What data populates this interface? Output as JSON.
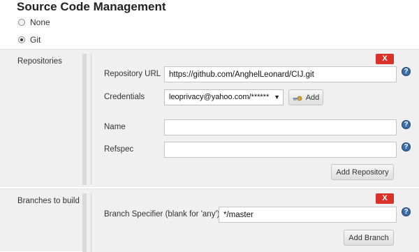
{
  "section_title": "Source Code Management",
  "scm_options": [
    {
      "label": "None",
      "checked": false
    },
    {
      "label": "Git",
      "checked": true
    }
  ],
  "repositories": {
    "label": "Repositories",
    "delete_label": "X",
    "repository_url_label": "Repository URL",
    "repository_url_value": "https://github.com/AnghelLeonard/CIJ.git",
    "credentials_label": "Credentials",
    "credentials_selected": "leoprivacy@yahoo.com/******",
    "credentials_arrow": "▼",
    "add_button_label": "Add",
    "name_label": "Name",
    "name_value": "",
    "refspec_label": "Refspec",
    "refspec_value": "",
    "add_repository_label": "Add Repository"
  },
  "branches": {
    "label": "Branches to build",
    "delete_label": "X",
    "branch_specifier_label": "Branch Specifier (blank for 'any')",
    "branch_specifier_value": "*/master",
    "add_branch_label": "Add Branch"
  },
  "help_glyph": "?",
  "colors": {
    "delete_red": "#d9322b",
    "help_blue": "#3f6fa8",
    "panel_bg": "#f0f0f0"
  },
  "icons": {
    "help": "help-icon",
    "key": "key-icon",
    "delete": "delete-icon"
  }
}
